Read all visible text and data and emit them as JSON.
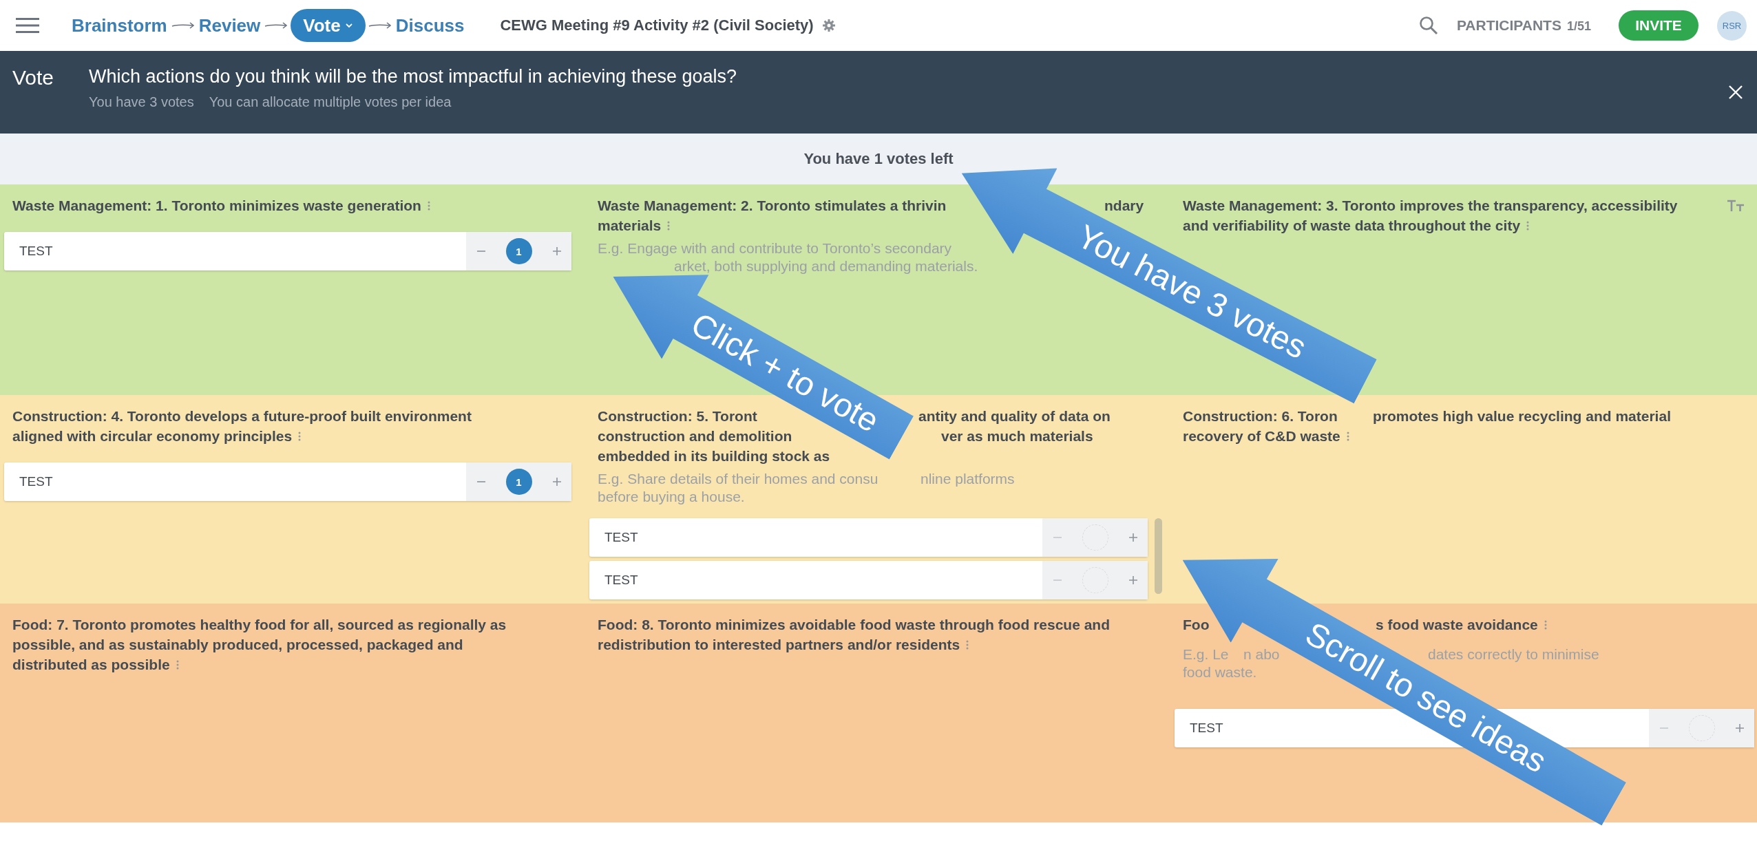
{
  "header": {
    "steps": [
      {
        "label": "Brainstorm",
        "selected": false
      },
      {
        "label": "Review",
        "selected": false
      },
      {
        "label": "Vote",
        "selected": true
      },
      {
        "label": "Discuss",
        "selected": false
      }
    ],
    "title": "CEWG Meeting #9 Activity #2 (Civil Society)",
    "participants_label": "PARTICIPANTS",
    "participants_count": "1/51",
    "invite": "INVITE",
    "avatar": "RSR"
  },
  "banner": {
    "label": "Vote",
    "question": "Which actions do you think will be the most impactful in achieving these goals?",
    "notes": [
      "You have 3 votes",
      "You can allocate multiple votes per idea"
    ]
  },
  "votes_left": "You have 1 votes left",
  "rows": [
    {
      "color": "#cde5a5",
      "cards": [
        {
          "title_lines": [
            [
              "Waste Management: 1. Toronto minimizes waste generation"
            ]
          ],
          "more_icon": true,
          "text_size_icon": false,
          "scrollable": false,
          "ideas": [
            {
              "text": "TEST",
              "votes": "1"
            }
          ]
        },
        {
          "title_lines": [
            [
              "Waste Management: 2. Toronto stimulates a thrivin",
              "ndary"
            ],
            [
              "materials"
            ]
          ],
          "more_icon": true,
          "text_size_icon": false,
          "description_lines": [
            [
              "E.g. Engage with and contribute to Toronto’s secondary"
            ],
            [
              "arket, both supplying and demanding materials."
            ]
          ]
        },
        {
          "title_lines": [
            [
              "Waste Management: 3. Toronto improves the transparency, accessibility"
            ],
            [
              "and verifiability of waste data throughout the city"
            ]
          ],
          "more_icon": true,
          "text_size_icon": true
        }
      ]
    },
    {
      "color": "#fbe5ae",
      "cards": [
        {
          "title_lines": [
            [
              "Construction: 4. Toronto develops a future-proof built environment"
            ],
            [
              "aligned with circular economy principles"
            ]
          ],
          "more_icon": true,
          "text_size_icon": false,
          "scrollable": false,
          "ideas": [
            {
              "text": "TEST",
              "votes": "1"
            }
          ]
        },
        {
          "title_lines": [
            [
              "Construction: 5. Toront",
              "antity and quality of data on"
            ],
            [
              "construction and demolition",
              "ver as much materials"
            ],
            [
              "embedded in its building stock as"
            ]
          ],
          "more_icon": false,
          "text_size_icon": false,
          "scrollable": true,
          "description_lines": [
            [
              "E.g. Share details of their homes and consu",
              "nline platforms"
            ],
            [
              "before buying a house."
            ]
          ],
          "ideas": [
            {
              "text": "TEST"
            },
            {
              "text": "TEST"
            }
          ]
        },
        {
          "title_lines": [
            [
              "Construction: 6. Toron",
              "promotes high value recycling and material"
            ],
            [
              "recovery of C&D waste"
            ]
          ],
          "more_icon": true,
          "text_size_icon": false
        }
      ]
    },
    {
      "color": "#f8ca9a",
      "cards": [
        {
          "title_lines": [
            [
              "Food: 7. Toronto promotes healthy food for all, sourced as regionally as"
            ],
            [
              "possible, and as sustainably produced, processed, packaged and"
            ],
            [
              "distributed as possible"
            ]
          ],
          "more_icon": true,
          "text_size_icon": false
        },
        {
          "title_lines": [
            [
              "Food: 8. Toronto minimizes avoidable food waste through food rescue and"
            ],
            [
              "redistribution to interested partners and/or residents"
            ]
          ],
          "more_icon": true,
          "text_size_icon": false
        },
        {
          "title_lines": [
            [
              "Foo",
              "s food waste avoidance"
            ]
          ],
          "more_icon": true,
          "text_size_icon": false,
          "scrollable": false,
          "description_lines": [
            [
              "E.g. Le",
              "n abo",
              "dates correctly to minimise"
            ],
            [
              "food waste."
            ]
          ],
          "ideas": [
            {
              "text": "TEST"
            }
          ]
        }
      ]
    }
  ],
  "callouts": [
    {
      "text": "You have 3 votes"
    },
    {
      "text": "Click + to vote"
    },
    {
      "text": "Scroll to see ideas"
    }
  ]
}
